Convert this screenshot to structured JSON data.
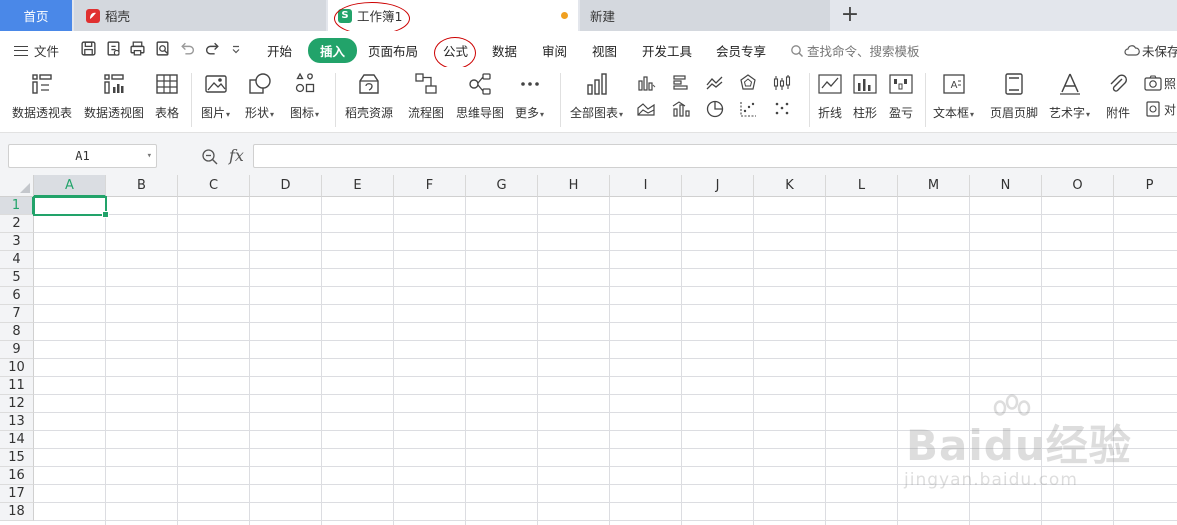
{
  "tabs": {
    "home": "首页",
    "daoke": "稻壳",
    "workbook": "工作簿1",
    "new": "新建",
    "plus": "+"
  },
  "menu": {
    "file": "文件",
    "tabs": [
      "开始",
      "插入",
      "页面布局",
      "公式",
      "数据",
      "审阅",
      "视图",
      "开发工具",
      "会员专享"
    ],
    "active_tab": "插入",
    "search_placeholder": "查找命令、搜索模板",
    "save_status": "未保存"
  },
  "ribbon": {
    "pivot_table": "数据透视表",
    "pivot_chart": "数据透视图",
    "table": "表格",
    "picture": "图片",
    "shape": "形状",
    "icon": "图标",
    "daoke_resource": "稻壳资源",
    "flowchart": "流程图",
    "mindmap": "思维导图",
    "more": "更多",
    "all_charts": "全部图表",
    "line_spark": "折线",
    "column_spark": "柱形",
    "winloss_spark": "盈亏",
    "textbox": "文本框",
    "header_footer": "页眉页脚",
    "wordart": "艺术字",
    "attachment": "附件",
    "photo": "照",
    "object": "对"
  },
  "formula_bar": {
    "name_box": "A1",
    "fx": "fx",
    "formula": ""
  },
  "sheet": {
    "columns": [
      "A",
      "B",
      "C",
      "D",
      "E",
      "F",
      "G",
      "H",
      "I",
      "J",
      "K",
      "L",
      "M",
      "N",
      "O",
      "P"
    ],
    "rows": [
      "1",
      "2",
      "3",
      "4",
      "5",
      "6",
      "7",
      "8",
      "9",
      "10",
      "11",
      "12",
      "13",
      "14",
      "15",
      "16",
      "17",
      "18"
    ],
    "selected_cell": "A1"
  },
  "watermark": {
    "brand": "Baidu经验",
    "url": "jingyan.baidu.com"
  },
  "colors": {
    "accent_green": "#22a36a",
    "home_tab_blue": "#4a88e8",
    "annotation_red": "#cc0000"
  }
}
